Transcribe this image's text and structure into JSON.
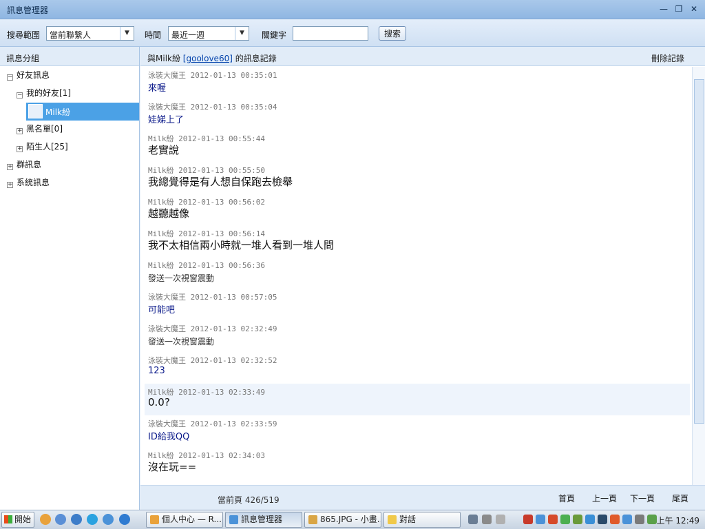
{
  "window": {
    "title": "訊息管理器",
    "min": "—",
    "restore": "❐",
    "close": "✕"
  },
  "toolbar": {
    "scope_label": "搜尋範圍",
    "scope_value": "當前聯繫人",
    "time_label": "時間",
    "time_value": "最近一週",
    "keyword_label": "關鍵字",
    "keyword_value": "",
    "search_button": "搜索"
  },
  "left": {
    "header": "訊息分組",
    "tree": {
      "friends": "好友訊息",
      "my_friends": "我的好友[1]",
      "contact": "Milk紛",
      "blacklist": "黑名單[0]",
      "strangers": "陌生人[25]",
      "groups": "群訊息",
      "system": "系統訊息"
    }
  },
  "main": {
    "header_prefix": "與Milk紛 ",
    "header_link": "[goolove60]",
    "header_suffix": " 的訊息記錄",
    "delete": "刪除記錄",
    "messages": [
      {
        "meta": "泳裝大魔王 2012-01-13 00:35:01",
        "text": "來喔",
        "style": "blue"
      },
      {
        "meta": "泳裝大魔王 2012-01-13 00:35:04",
        "text": "娃娣上了",
        "style": "blue"
      },
      {
        "meta": "Milk紛 2012-01-13 00:55:44",
        "text": "老實說",
        "style": "big"
      },
      {
        "meta": "Milk紛 2012-01-13 00:55:50",
        "text": "我總覺得是有人想自保跑去檢舉",
        "style": "big"
      },
      {
        "meta": "Milk紛 2012-01-13 00:56:02",
        "text": "越聽越像",
        "style": "big"
      },
      {
        "meta": "Milk紛 2012-01-13 00:56:14",
        "text": "我不太相信兩小時就一堆人看到一堆人問",
        "style": "big"
      },
      {
        "meta": "Milk紛 2012-01-13 00:56:36",
        "text": "發送一次視窗震動",
        "style": "gray"
      },
      {
        "meta": "泳裝大魔王 2012-01-13 00:57:05",
        "text": "可能吧",
        "style": "blue"
      },
      {
        "meta": "泳裝大魔王 2012-01-13 02:32:49",
        "text": "發送一次視窗震動",
        "style": "gray"
      },
      {
        "meta": "泳裝大魔王 2012-01-13 02:32:52",
        "text": "123",
        "style": "blue"
      },
      {
        "meta": "Milk紛 2012-01-13 02:33:49",
        "text": "0.0?",
        "style": "big"
      },
      {
        "meta": "泳裝大魔王 2012-01-13 02:33:59",
        "text": "ID給我QQ",
        "style": "blue"
      },
      {
        "meta": "Milk紛 2012-01-13 02:34:03",
        "text": "沒在玩==",
        "style": "big"
      }
    ],
    "pager": {
      "current": "當前頁 426/519",
      "first": "首頁",
      "prev": "上一頁",
      "next": "下一頁",
      "last": "尾頁"
    }
  },
  "taskbar": {
    "start": "開始",
    "tasks": [
      "個人中心 — R...",
      "訊息管理器",
      "865.JPG - 小畫...",
      "對話"
    ],
    "clock": "上午 12:49"
  },
  "colors": {
    "selection": "#4ba1e6",
    "title_bar": "#8fb6e2",
    "message_blue": "#0b1a8a"
  }
}
